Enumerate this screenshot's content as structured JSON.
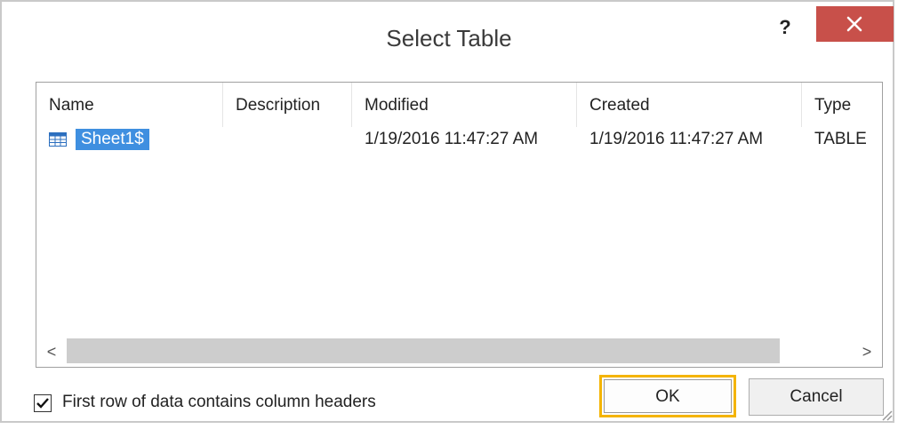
{
  "dialog": {
    "title": "Select Table",
    "help_label": "?",
    "close_icon": "close-x-icon"
  },
  "table": {
    "columns": [
      "Name",
      "Description",
      "Modified",
      "Created",
      "Type"
    ],
    "rows": [
      {
        "name": "Sheet1$",
        "description": "",
        "modified": "1/19/2016 11:47:27 AM",
        "created": "1/19/2016 11:47:27 AM",
        "type": "TABLE",
        "icon": "table-grid-icon",
        "selected": true
      }
    ]
  },
  "scrollbar": {
    "left_arrow": "<",
    "right_arrow": ">"
  },
  "options": {
    "first_row_headers_label": "First row of data contains column headers",
    "first_row_headers_checked": true
  },
  "buttons": {
    "ok_label": "OK",
    "cancel_label": "Cancel"
  },
  "colors": {
    "close_button": "#c8504a",
    "selection": "#3f8fe0",
    "focus_outline": "#f4b400"
  }
}
